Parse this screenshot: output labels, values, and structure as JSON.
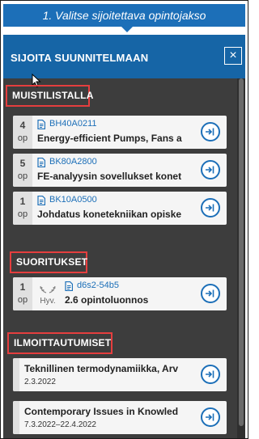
{
  "stepbar": {
    "label": "1. Valitse sijoitettava opintojakso"
  },
  "panel": {
    "title": "SIJOITA SUUNNITELMAAN",
    "close_label": "×"
  },
  "sections": {
    "memo": {
      "label": "MUISTILISTALLA",
      "items": [
        {
          "credits": "4",
          "unit": "op",
          "code": "BH40A0211",
          "name": "Energy-efficient Pumps, Fans a"
        },
        {
          "credits": "5",
          "unit": "op",
          "code": "BK80A2800",
          "name": "FE-analyysin sovellukset konet"
        },
        {
          "credits": "1",
          "unit": "op",
          "code": "BK10A0500",
          "name": "Johdatus konetekniikan opiske"
        }
      ]
    },
    "completed": {
      "label": "SUORITUKSET",
      "items": [
        {
          "credits": "1",
          "unit": "op",
          "grade": "Hyv.",
          "code": "d6s2-54b5",
          "name": "2.6 opintoluonnos"
        }
      ]
    },
    "registrations": {
      "label": "ILMOITTAUTUMISET",
      "items": [
        {
          "name": "Teknillinen termodynamiikka, Arv",
          "date": "2.3.2022"
        },
        {
          "name": "Contemporary Issues in Knowled",
          "date": "7.3.2022–22.4.2022"
        }
      ]
    }
  },
  "colors": {
    "accent": "#1c6fb8",
    "header": "#1665a6",
    "panel": "#3d3d3d",
    "highlight": "#e53e3e"
  },
  "icons": {
    "doc": "document-icon",
    "go": "arrow-into-circle-icon",
    "close": "close-icon",
    "laurel": "laurel-icon"
  }
}
